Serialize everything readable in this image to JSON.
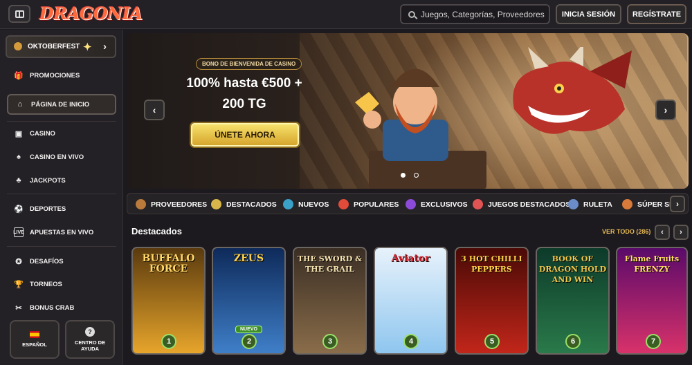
{
  "header": {
    "logo": "DRAGONIA",
    "search_placeholder": "Juegos, Categorías, Proveedores",
    "login_label": "INICIA SESIÓN",
    "register_label": "REGÍSTRATE"
  },
  "sidebar": {
    "promo_label": "OKTOBERFEST",
    "items": [
      {
        "label": "PROMOCIONES",
        "icon": "gift-icon"
      },
      {
        "label": "PÁGINA DE INICIO",
        "icon": "home-icon",
        "active": true
      },
      {
        "label": "CASINO",
        "icon": "slot-machine-icon"
      },
      {
        "label": "CASINO EN VIVO",
        "icon": "cards-icon"
      },
      {
        "label": "JACKPOTS",
        "icon": "clover-icon"
      },
      {
        "label": "DEPORTES",
        "icon": "ball-icon"
      },
      {
        "label": "APUESTAS EN VIVO",
        "icon": "live-icon"
      },
      {
        "label": "DESAFÍOS",
        "icon": "challenge-icon"
      },
      {
        "label": "TORNEOS",
        "icon": "trophy-icon"
      },
      {
        "label": "BONUS CRAB",
        "icon": "crab-icon"
      }
    ],
    "language_label": "ESPAÑOL",
    "help_label": "CENTRO DE AYUDA"
  },
  "hero": {
    "tag": "BONO DE BIENVENIDA DE CASINO",
    "title_line1": "100% hasta €500 +",
    "title_line2": "200 TG",
    "cta_label": "ÚNETE AHORA",
    "slides": 2,
    "active_slide": 1
  },
  "categories": [
    {
      "label": "PROVEEDORES",
      "color": "#b97a3c"
    },
    {
      "label": "DESTACADOS",
      "color": "#d8b64b"
    },
    {
      "label": "NUEVOS",
      "color": "#3aa0c8"
    },
    {
      "label": "POPULARES",
      "color": "#e04b3a"
    },
    {
      "label": "EXCLUSIVOS",
      "color": "#8b4bd8"
    },
    {
      "label": "JUEGOS DESTACADOS",
      "color": "#e05454"
    },
    {
      "label": "RULETA",
      "color": "#6a8cc8"
    },
    {
      "label": "SÚPER SH",
      "color": "#d87a3a"
    }
  ],
  "featured": {
    "title": "Destacados",
    "see_all": "VER TODO (286)",
    "games": [
      {
        "title": "BUFFALO FORCE",
        "rank": "1",
        "bg1": "#5a3a0e",
        "bg2": "#e7a52b",
        "color": "#ffd76a"
      },
      {
        "title": "ZEUS",
        "rank": "2",
        "bg1": "#0e2a5a",
        "bg2": "#3f7fc8",
        "color": "#ffd24a",
        "badge": "NUEVO"
      },
      {
        "title": "THE SWORD & THE GRAIL",
        "rank": "3",
        "bg1": "#3a2e24",
        "bg2": "#8a6d4a",
        "color": "#f3e1b0"
      },
      {
        "title": "Aviator",
        "rank": "4",
        "bg1": "#e7f2fb",
        "bg2": "#8fc6ef",
        "color": "#d6202a"
      },
      {
        "title": "3 HOT CHILLI PEPPERS",
        "rank": "5",
        "bg1": "#4a0a06",
        "bg2": "#c2261a",
        "color": "#ffd24a"
      },
      {
        "title": "BOOK OF DRAGON HOLD AND WIN",
        "rank": "6",
        "bg1": "#0d3a2a",
        "bg2": "#2a7a4a",
        "color": "#f0c64a"
      },
      {
        "title": "Flame Fruits FRENZY",
        "rank": "7",
        "bg1": "#5a0a6a",
        "bg2": "#d8326a",
        "color": "#ffe066"
      }
    ]
  }
}
